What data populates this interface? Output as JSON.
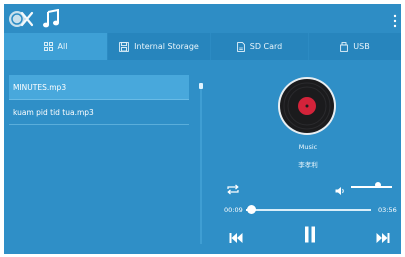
{
  "topbar": {
    "logo_icon": "logo-icon",
    "music_icon": "music-note-icon",
    "menu_icon": "overflow-menu-icon"
  },
  "tabs": [
    {
      "label": "All",
      "icon": "grid-icon",
      "active": true
    },
    {
      "label": "Internal Storage",
      "icon": "storage-icon",
      "active": false
    },
    {
      "label": "SD Card",
      "icon": "sd-card-icon",
      "active": false
    },
    {
      "label": "USB",
      "icon": "usb-icon",
      "active": false
    }
  ],
  "playlist": [
    {
      "name": "MINUTES.mp3",
      "selected": true
    },
    {
      "name": "kuam pid tid tua.mp3",
      "selected": false
    }
  ],
  "player": {
    "title": "Music",
    "artist": "李孝利",
    "current_time": "00:09",
    "total_time": "03:56",
    "progress": 0.04,
    "volume": 0.65
  },
  "colors": {
    "background": "#2f8fc7",
    "tab_active": "#3ea0d6",
    "record_label": "#d3233a"
  }
}
